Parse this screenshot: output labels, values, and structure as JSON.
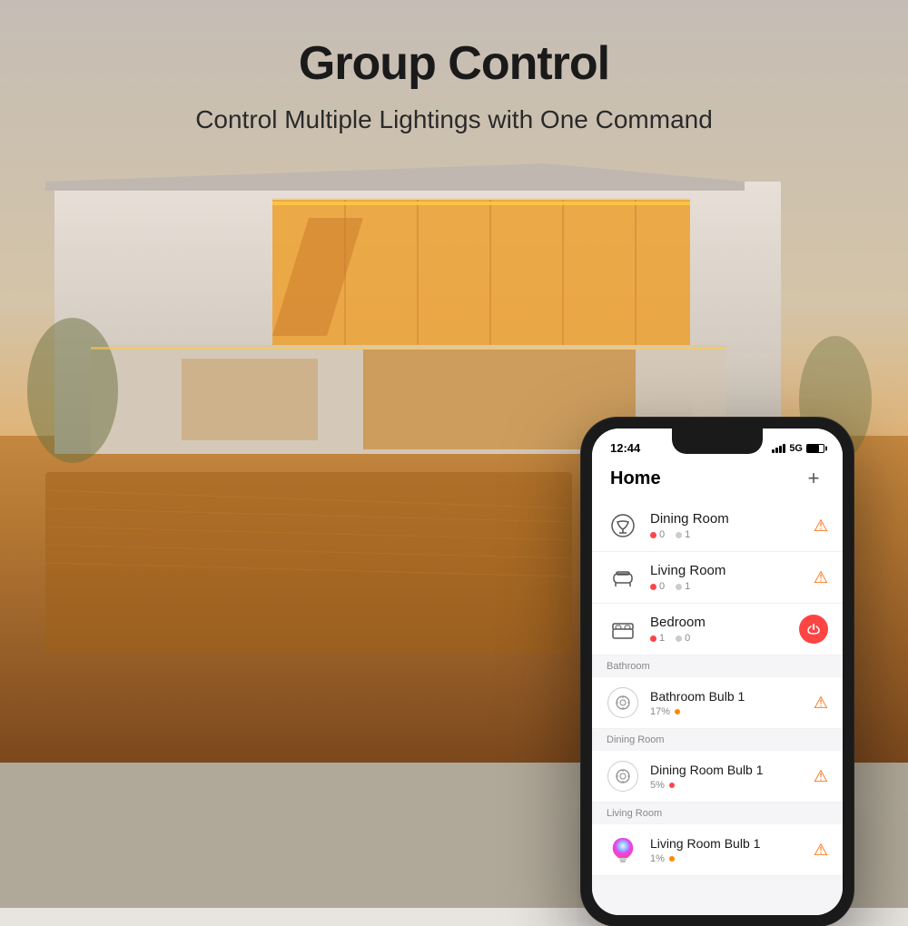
{
  "header": {
    "main_title": "Group Control",
    "subtitle": "Control Multiple Lightings with One Command"
  },
  "phone": {
    "status_bar": {
      "time": "12:44",
      "network": "5G"
    },
    "app_header": {
      "title": "Home",
      "add_label": "+"
    },
    "rooms": [
      {
        "name": "Dining Room",
        "icon": "🍽",
        "on_count": "0",
        "off_count": "1",
        "action": "alert"
      },
      {
        "name": "Living Room",
        "icon": "🛋",
        "on_count": "0",
        "off_count": "1",
        "action": "alert"
      },
      {
        "name": "Bedroom",
        "icon": "🛏",
        "on_count": "1",
        "off_count": "0",
        "action": "power"
      }
    ],
    "device_sections": [
      {
        "section_name": "Bathroom",
        "devices": [
          {
            "name": "Bathroom Bulb 1",
            "brightness": "17%",
            "status_color": "orange",
            "action": "alert"
          }
        ]
      },
      {
        "section_name": "Dining Room",
        "devices": [
          {
            "name": "Dining Room Bulb 1",
            "brightness": "5%",
            "status_color": "red",
            "action": "alert"
          }
        ]
      },
      {
        "section_name": "Living Room",
        "devices": [
          {
            "name": "Living Room Bulb 1",
            "brightness": "1%",
            "status_color": "multicolor",
            "action": "alert"
          }
        ]
      }
    ]
  }
}
